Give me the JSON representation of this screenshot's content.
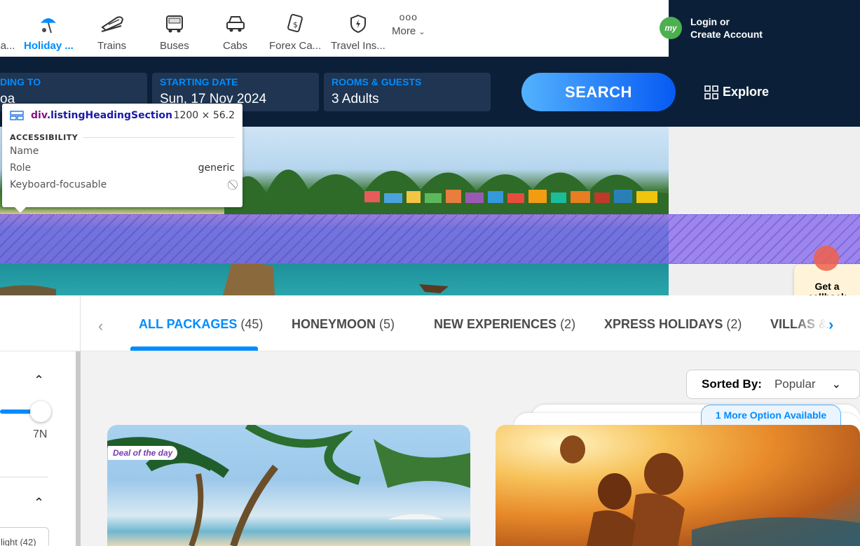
{
  "nav": {
    "items": [
      {
        "label": "a...",
        "icon": "flight-hotel-icon"
      },
      {
        "label": "Holiday ...",
        "icon": "holiday-umbrella-icon",
        "active": true
      },
      {
        "label": "Trains",
        "icon": "train-icon"
      },
      {
        "label": "Buses",
        "icon": "bus-icon"
      },
      {
        "label": "Cabs",
        "icon": "cab-icon"
      },
      {
        "label": "Forex Ca...",
        "icon": "forex-card-icon"
      },
      {
        "label": "Travel Ins...",
        "icon": "travel-insurance-icon"
      }
    ],
    "more_label": "More",
    "more_dots": "ooo",
    "login_line1": "Login or",
    "login_line2": "Create Account",
    "logo_text": "my"
  },
  "search": {
    "going_label": "DING TO",
    "going_value": "oa",
    "date_label": "STARTING DATE",
    "date_value": "Sun, 17 Nov 2024",
    "rooms_label": "ROOMS & GUESTS",
    "rooms_value": "3 Adults",
    "button": "SEARCH",
    "explore": "Explore"
  },
  "devtools": {
    "element": "div",
    "class_name": ".listingHeadingSection",
    "size": "1200 × 56.2",
    "section": "ACCESSIBILITY",
    "rows": [
      {
        "k": "Name",
        "v": ""
      },
      {
        "k": "Role",
        "v": "generic"
      },
      {
        "k": "Keyboard-focusable",
        "v": "⃠"
      }
    ]
  },
  "callback": {
    "line1": "Get a",
    "line2": "callback"
  },
  "tabs": [
    {
      "label": "ALL PACKAGES",
      "count": "(45)",
      "active": true
    },
    {
      "label": "HONEYMOON",
      "count": "(5)"
    },
    {
      "label": "NEW EXPERIENCES",
      "count": "(2)"
    },
    {
      "label": "XPRESS HOLIDAYS",
      "count": "(2)"
    },
    {
      "label": "VILLAS &",
      "count": ""
    }
  ],
  "filters": {
    "nights_value": "7N",
    "chip_label": "light (42)"
  },
  "sort": {
    "label": "Sorted By:",
    "value": "Popular"
  },
  "more_option": "1 More Option Available",
  "cards": [
    {
      "badge": "Deal of the day"
    }
  ],
  "colors": {
    "brand_blue": "#008cff",
    "dark_header": "#0b2038",
    "highlight": "#8668ec"
  }
}
